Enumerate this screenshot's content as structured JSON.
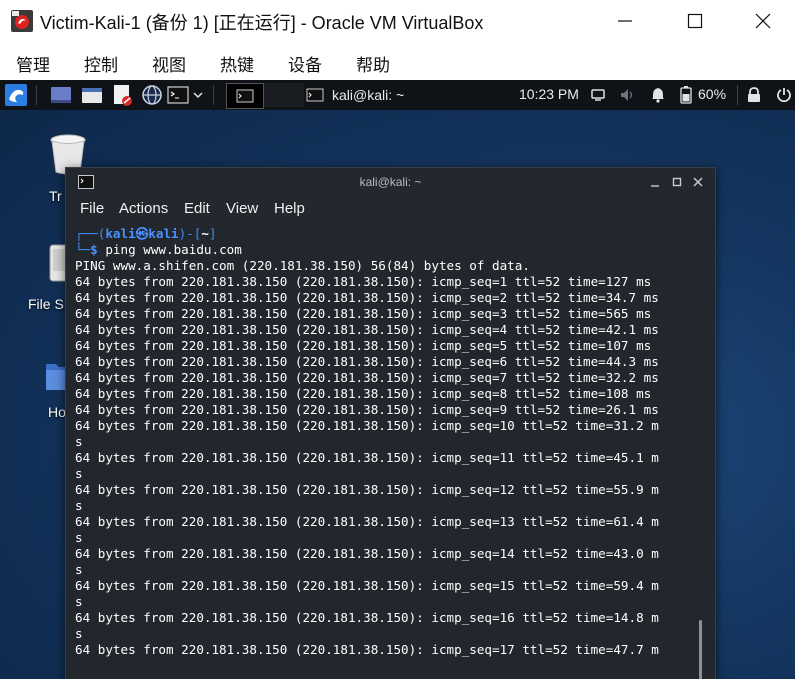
{
  "window": {
    "title": "Victim-Kali-1 (备份 1) [正在运行] - Oracle VM VirtualBox",
    "minimize": "—",
    "maximize": "☐",
    "close": "✕"
  },
  "menubar": {
    "items": [
      "管理",
      "控制",
      "视图",
      "热键",
      "设备",
      "帮助"
    ]
  },
  "panel": {
    "task_label": "kali@kali: ~",
    "clock": "10:23 PM",
    "battery": "60%"
  },
  "desktop": {
    "icons": [
      {
        "label": "Tr",
        "icon": "trash-icon"
      },
      {
        "label": "File S",
        "icon": "filesystem-icon"
      },
      {
        "label": "Ho",
        "icon": "home-folder-icon"
      }
    ]
  },
  "terminal": {
    "title": "kali@kali: ~",
    "menu": [
      "File",
      "Actions",
      "Edit",
      "View",
      "Help"
    ],
    "prompt": {
      "top_open": "┌──(",
      "user": "kali",
      "at": "㉿",
      "host": "kali",
      "mid": ")-[",
      "dir": "~",
      "top_close": "]",
      "bottom": "└─",
      "dollar": "$",
      "command": " ping www.baidu.com"
    },
    "output": [
      "PING www.a.shifen.com (220.181.38.150) 56(84) bytes of data.",
      "64 bytes from 220.181.38.150 (220.181.38.150): icmp_seq=1 ttl=52 time=127 ms",
      "64 bytes from 220.181.38.150 (220.181.38.150): icmp_seq=2 ttl=52 time=34.7 ms",
      "64 bytes from 220.181.38.150 (220.181.38.150): icmp_seq=3 ttl=52 time=565 ms",
      "64 bytes from 220.181.38.150 (220.181.38.150): icmp_seq=4 ttl=52 time=42.1 ms",
      "64 bytes from 220.181.38.150 (220.181.38.150): icmp_seq=5 ttl=52 time=107 ms",
      "64 bytes from 220.181.38.150 (220.181.38.150): icmp_seq=6 ttl=52 time=44.3 ms",
      "64 bytes from 220.181.38.150 (220.181.38.150): icmp_seq=7 ttl=52 time=32.2 ms",
      "64 bytes from 220.181.38.150 (220.181.38.150): icmp_seq=8 ttl=52 time=108 ms",
      "64 bytes from 220.181.38.150 (220.181.38.150): icmp_seq=9 ttl=52 time=26.1 ms",
      "64 bytes from 220.181.38.150 (220.181.38.150): icmp_seq=10 ttl=52 time=31.2 m",
      "s",
      "64 bytes from 220.181.38.150 (220.181.38.150): icmp_seq=11 ttl=52 time=45.1 m",
      "s",
      "64 bytes from 220.181.38.150 (220.181.38.150): icmp_seq=12 ttl=52 time=55.9 m",
      "s",
      "64 bytes from 220.181.38.150 (220.181.38.150): icmp_seq=13 ttl=52 time=61.4 m",
      "s",
      "64 bytes from 220.181.38.150 (220.181.38.150): icmp_seq=14 ttl=52 time=43.0 m",
      "s",
      "64 bytes from 220.181.38.150 (220.181.38.150): icmp_seq=15 ttl=52 time=59.4 m",
      "s",
      "64 bytes from 220.181.38.150 (220.181.38.150): icmp_seq=16 ttl=52 time=14.8 m",
      "s",
      "64 bytes from 220.181.38.150 (220.181.38.150): icmp_seq=17 ttl=52 time=47.7 m"
    ]
  }
}
